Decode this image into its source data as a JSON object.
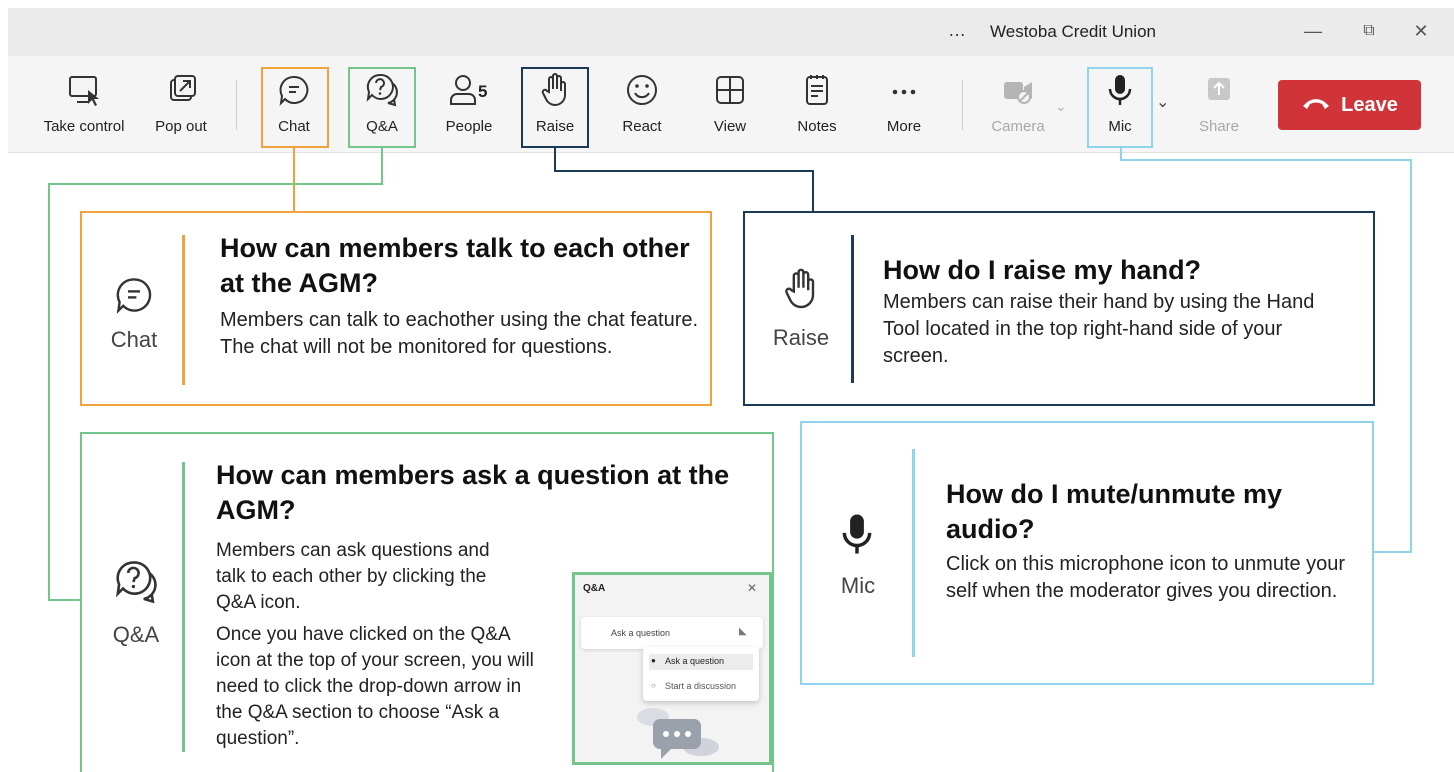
{
  "window": {
    "title": "Westoba Credit Union",
    "dots": "…",
    "minimize": "—",
    "maximize": "⧉",
    "close": "✕"
  },
  "toolbar": {
    "take_control": "Take control",
    "pop_out": "Pop out",
    "chat": "Chat",
    "qa": "Q&A",
    "people": "People",
    "people_count": "5",
    "raise": "Raise",
    "react": "React",
    "view": "View",
    "notes": "Notes",
    "more": "More",
    "camera": "Camera",
    "mic": "Mic",
    "share": "Share",
    "leave": "Leave"
  },
  "colors": {
    "chat": "#f0a23c",
    "qa": "#73c58a",
    "raise": "#1b3a57",
    "mic": "#8fd3ec",
    "leave": "#d13438"
  },
  "cards": {
    "chat": {
      "label": "Chat",
      "heading": "How can members talk to each other at the AGM?",
      "body": "Members can talk to eachother using the chat feature. The chat will not be monitored for questions."
    },
    "raise": {
      "label": "Raise",
      "heading": "How do I raise my hand?",
      "body": "Members can raise their hand by using the Hand Tool located in the top right-hand side of your screen."
    },
    "qa": {
      "label": "Q&A",
      "heading": "How can members ask a question at the AGM?",
      "body1": "Members can ask questions and talk to each other by clicking the Q&A icon.",
      "body2": "Once you have clicked on the Q&A icon at the top of your screen, you will need to click the drop-down arrow in the Q&A section to choose “Ask a question”."
    },
    "mic": {
      "label": "Mic",
      "heading": "How do I mute/unmute my audio?",
      "body": "Click on this microphone icon to unmute your self when the moderator gives you direction."
    }
  },
  "qa_mock": {
    "title": "Q&A",
    "close": "✕",
    "placeholder": "Ask a question",
    "options": [
      "Ask a question",
      "Start a discussion"
    ]
  }
}
